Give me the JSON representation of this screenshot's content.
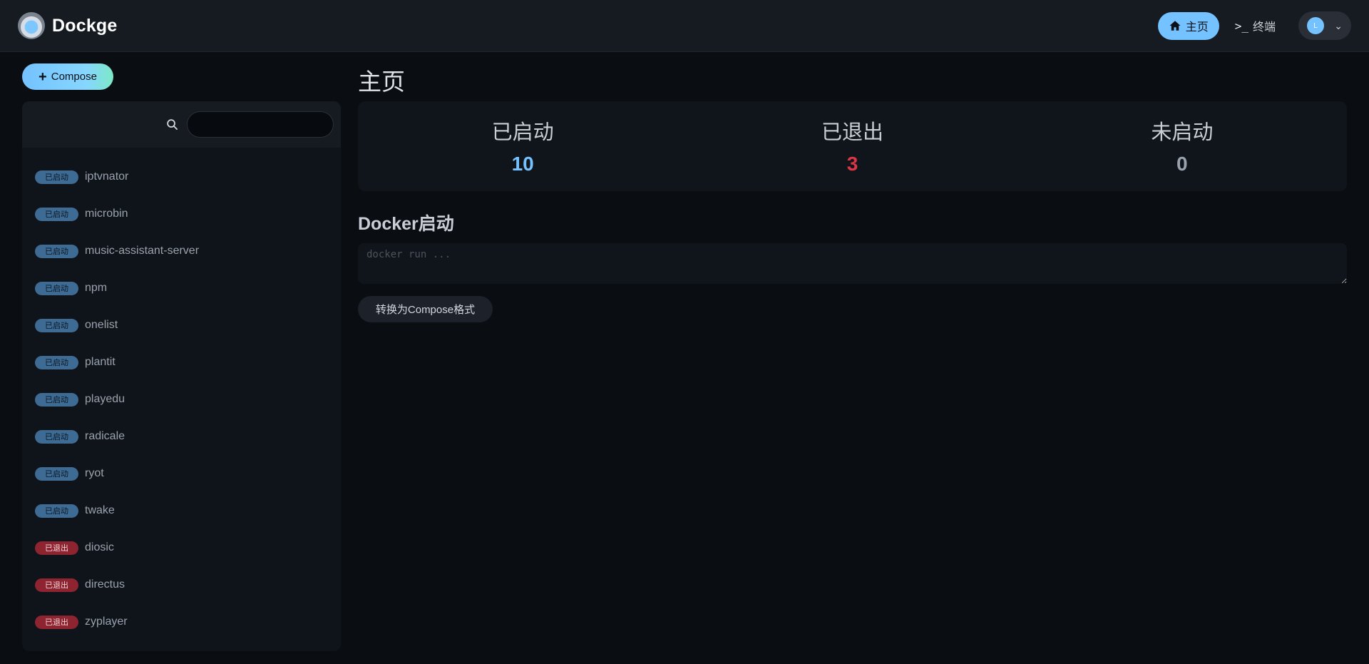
{
  "header": {
    "brand": "Dockge",
    "nav": {
      "home_label": "主页",
      "terminal_label": "终端"
    },
    "profile": {
      "avatar_letter": "L"
    }
  },
  "sidebar": {
    "compose_button_label": "Compose",
    "search": {
      "value": "",
      "placeholder": ""
    },
    "stacks": [
      {
        "status": "已启动",
        "status_type": "active",
        "name": "iptvnator"
      },
      {
        "status": "已启动",
        "status_type": "active",
        "name": "microbin"
      },
      {
        "status": "已启动",
        "status_type": "active",
        "name": "music-assistant-server"
      },
      {
        "status": "已启动",
        "status_type": "active",
        "name": "npm"
      },
      {
        "status": "已启动",
        "status_type": "active",
        "name": "onelist"
      },
      {
        "status": "已启动",
        "status_type": "active",
        "name": "plantit"
      },
      {
        "status": "已启动",
        "status_type": "active",
        "name": "playedu"
      },
      {
        "status": "已启动",
        "status_type": "active",
        "name": "radicale"
      },
      {
        "status": "已启动",
        "status_type": "active",
        "name": "ryot"
      },
      {
        "status": "已启动",
        "status_type": "active",
        "name": "twake"
      },
      {
        "status": "已退出",
        "status_type": "exited",
        "name": "diosic"
      },
      {
        "status": "已退出",
        "status_type": "exited",
        "name": "directus"
      },
      {
        "status": "已退出",
        "status_type": "exited",
        "name": "zyplayer"
      }
    ]
  },
  "main": {
    "title": "主页",
    "stats": [
      {
        "label": "已启动",
        "value": "10",
        "color": "#74c2ff"
      },
      {
        "label": "已退出",
        "value": "3",
        "color": "#dc3545"
      },
      {
        "label": "未启动",
        "value": "0",
        "color": "#9aa3ad"
      }
    ],
    "docker_run": {
      "section_title": "Docker启动",
      "placeholder": "docker run ...",
      "value": "",
      "convert_button_label": "转换为Compose格式"
    }
  },
  "colors": {
    "accent": "#74c2ff",
    "danger": "#dc3545",
    "background": "#0a0d12",
    "panel": "#10141b"
  }
}
